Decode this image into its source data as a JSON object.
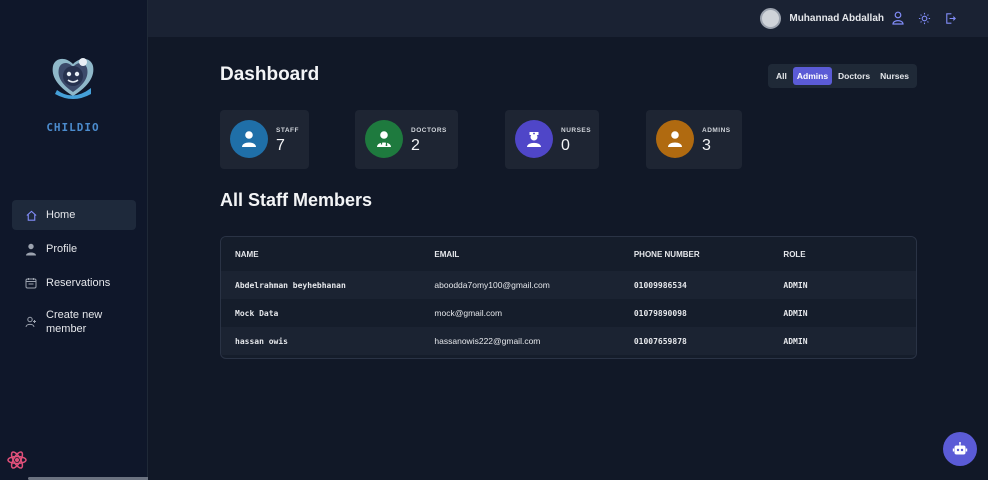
{
  "app": {
    "brand": "CHILDIO"
  },
  "topbar": {
    "user_name": "Muhannad Abdallah",
    "icons": [
      "user-icon",
      "sun-icon",
      "logout-icon"
    ]
  },
  "sidebar": {
    "items": [
      {
        "label": "Home",
        "icon": "home-icon",
        "active": true
      },
      {
        "label": "Profile",
        "icon": "person-icon",
        "active": false
      },
      {
        "label": "Reservations",
        "icon": "calendar-icon",
        "active": false
      },
      {
        "label_line1": "Create new",
        "label_line2": "member",
        "icon": "add-user-icon",
        "active": false
      }
    ]
  },
  "main": {
    "title": "Dashboard",
    "filters": [
      {
        "label": "All",
        "active": false
      },
      {
        "label": "Admins",
        "active": true
      },
      {
        "label": "Doctors",
        "active": false
      },
      {
        "label": "Nurses",
        "active": false
      }
    ],
    "stats": [
      {
        "label": "STAFF",
        "value": "7",
        "color": "#1f6fa8"
      },
      {
        "label": "DOCTORS",
        "value": "2",
        "color": "#1e7a3e"
      },
      {
        "label": "NURSES",
        "value": "0",
        "color": "#4f46c8"
      },
      {
        "label": "ADMINS",
        "value": "3",
        "color": "#b06a10"
      }
    ],
    "section_title": "All Staff Members",
    "table": {
      "headers": [
        "NAME",
        "EMAIL",
        "PHONE NUMBER",
        "ROLE"
      ],
      "rows": [
        [
          "Abdelrahman beyhebhanan",
          "aboodda7omy100@gmail.com",
          "01009986534",
          "ADMIN"
        ],
        [
          "Mock Data",
          "mock@gmail.com",
          "01079890098",
          "ADMIN"
        ],
        [
          "hassan owis",
          "hassanowis222@gmail.com",
          "01007659878",
          "ADMIN"
        ]
      ]
    }
  },
  "colors": {
    "accent": "#5b5bd6",
    "bg": "#111827",
    "sidebar": "#0f172a",
    "brand_text": "#4b8bcd"
  }
}
